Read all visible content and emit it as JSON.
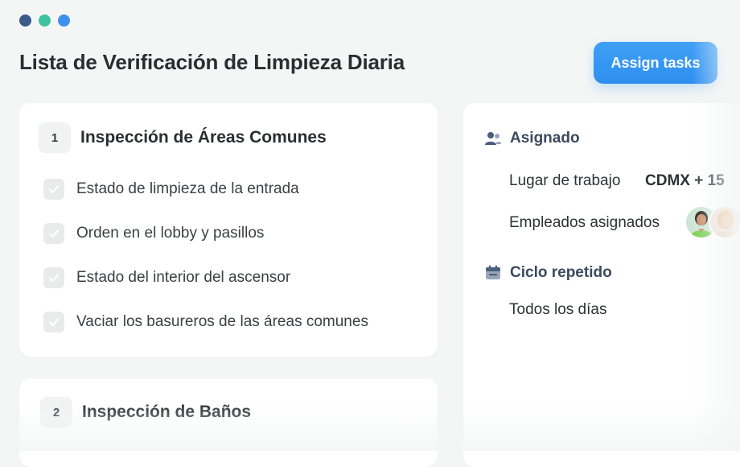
{
  "window": {
    "dots": [
      "#3a5a8c",
      "#3fc2a0",
      "#3d8ff0"
    ]
  },
  "header": {
    "title": "Lista de Verificación de Limpieza Diaria",
    "assign_button": "Assign tasks",
    "accent_gradient": [
      "#3fa0f5",
      "#2d8ef0"
    ]
  },
  "checklist": {
    "sections": [
      {
        "number": "1",
        "title": "Inspección de Áreas Comunes",
        "items": [
          "Estado de limpieza de la entrada",
          "Orden en el lobby y pasillos",
          "Estado del interior del ascensor",
          "Vaciar los basureros de las áreas comunes"
        ]
      },
      {
        "number": "2",
        "title": "Inspección de Baños",
        "items": []
      }
    ]
  },
  "sidebar": {
    "assigned": {
      "icon": "users-icon",
      "label": "Asignado",
      "workplace_label": "Lugar de trabajo",
      "workplace_value": "CDMX + 15",
      "employees_label": "Empleados asignados"
    },
    "repeat": {
      "icon": "calendar-icon",
      "label": "Ciclo repetido",
      "value": "Todos los días"
    }
  }
}
